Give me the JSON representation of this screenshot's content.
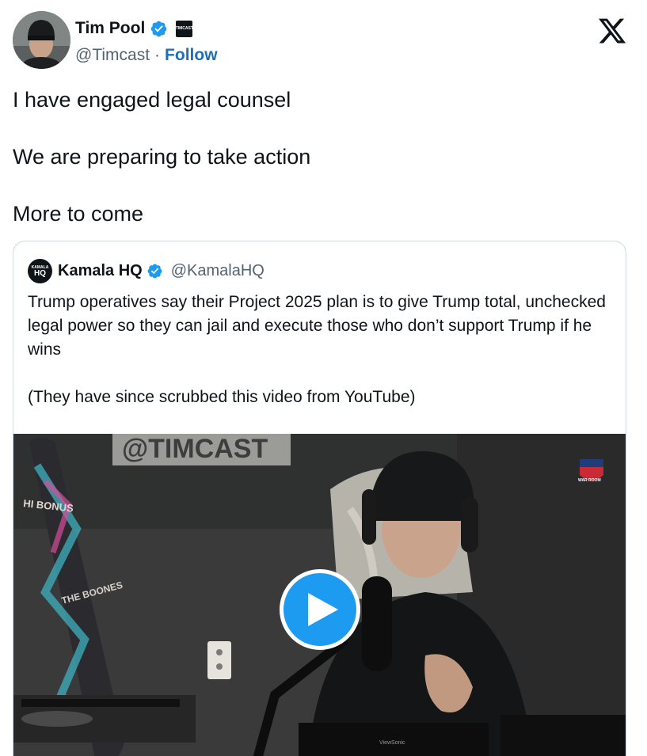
{
  "author": {
    "name": "Tim Pool",
    "handle": "@Timcast",
    "separator": "·",
    "follow_label": "Follow",
    "affiliate_badge": "TIMCAST"
  },
  "tweet": {
    "lines": [
      "I have engaged legal counsel",
      "We are preparing to take action",
      "More to come"
    ]
  },
  "quoted": {
    "avatar_top": "KAMALA",
    "avatar_main": "HQ",
    "name": "Kamala HQ",
    "handle": "@KamalaHQ",
    "text_line1": "Trump operatives say their Project 2025 plan is to give Trump total, unchecked legal power so they can jail and execute those who don’t support Trump if he wins",
    "text_line2": "(They have since scrubbed this video from YouTube)"
  },
  "video": {
    "wall_sign": "@TIMCAST",
    "skate_text1": "HI BONUS",
    "skate_text2": "THE BOONES",
    "corner_logo": "WAR ROOM",
    "monitor_brand": "ViewSonic"
  },
  "colors": {
    "verified": "#1d9bf0",
    "follow": "#1d70b8",
    "text": "#0f1419",
    "muted": "#536471",
    "border": "#cfd9de"
  },
  "icons": [
    "verified-badge-icon",
    "x-logo-icon",
    "play-icon"
  ]
}
